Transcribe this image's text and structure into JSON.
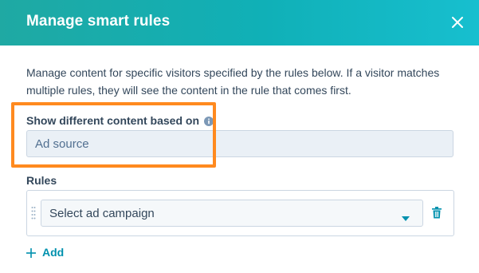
{
  "modal": {
    "title": "Manage smart rules",
    "close_icon": "close-icon"
  },
  "description": "Manage content for specific visitors specified by the rules below. If a visitor matches multiple rules, they will see the content in the rule that comes first.",
  "content_basis": {
    "label": "Show different content based on",
    "info_icon": "info-icon",
    "value": "Ad source"
  },
  "rules": {
    "label": "Rules",
    "items": [
      {
        "placeholder": "Select ad campaign",
        "drag_icon": "drag-handle-icon",
        "delete_icon": "trash-icon"
      }
    ],
    "add_label": "Add"
  },
  "colors": {
    "header_gradient_start": "#1fa9a3",
    "header_gradient_end": "#17bfcf",
    "highlight": "#ff8a1f",
    "link": "#0091ae",
    "text": "#33475b"
  }
}
